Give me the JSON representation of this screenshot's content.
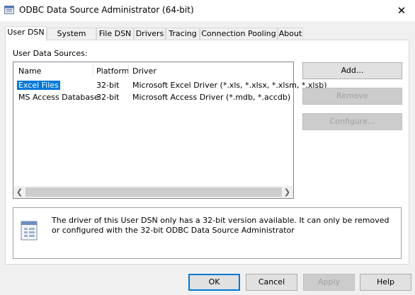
{
  "window": {
    "title": "ODBC Data Source Administrator (64-bit)"
  },
  "tabs": [
    {
      "label": "User DSN"
    },
    {
      "label": "System DSN"
    },
    {
      "label": "File DSN"
    },
    {
      "label": "Drivers"
    },
    {
      "label": "Tracing"
    },
    {
      "label": "Connection Pooling"
    },
    {
      "label": "About"
    }
  ],
  "list": {
    "label": "User Data Sources:",
    "columns": [
      "Name",
      "Platform",
      "Driver"
    ],
    "rows": [
      {
        "name": "Excel Files",
        "platform": "32-bit",
        "driver": "Microsoft Excel Driver (*.xls, *.xlsx, *.xlsm, *.xlsb)"
      },
      {
        "name": "MS Access Database",
        "platform": "32-bit",
        "driver": "Microsoft Access Driver (*.mdb, *.accdb)"
      }
    ]
  },
  "buttons": {
    "add": "Add...",
    "remove": "Remove",
    "configure": "Configure..."
  },
  "info": {
    "text": "The driver of this User DSN only has a 32-bit version available. It can only be removed or configured with the 32-bit ODBC Data Source Administrator"
  },
  "footer": {
    "ok": "OK",
    "cancel": "Cancel",
    "apply": "Apply",
    "help": "Help"
  },
  "colors": {
    "selection": "#0078d7",
    "default_button_border": "#0078d7"
  }
}
